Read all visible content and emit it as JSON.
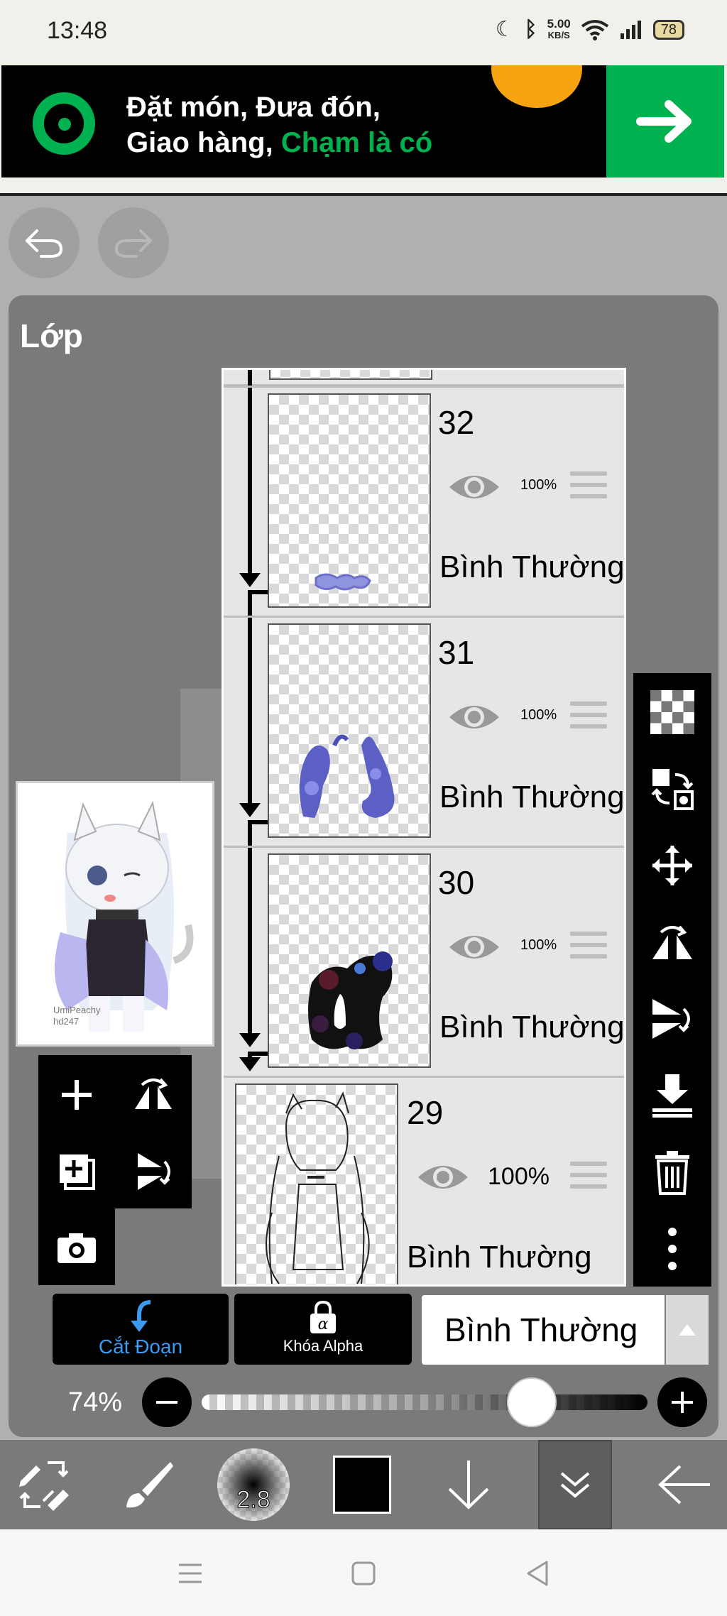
{
  "status": {
    "time": "13:48",
    "net_speed_value": "5.00",
    "net_speed_unit": "KB/S",
    "battery": "78"
  },
  "ad": {
    "line1": "Đặt món, Đưa đón,",
    "line2_white": "Giao hàng,",
    "line2_green": "Chạm là có"
  },
  "panel": {
    "title": "Lớp",
    "preview_watermark_1": "UmiPeachy",
    "preview_watermark_2": "hd247"
  },
  "layers": [
    {
      "number": "32",
      "opacity": "100%",
      "blend": "Bình Thường"
    },
    {
      "number": "31",
      "opacity": "100%",
      "blend": "Bình Thường"
    },
    {
      "number": "30",
      "opacity": "100%",
      "blend": "Bình Thường"
    },
    {
      "number": "29",
      "opacity": "100%",
      "blend": "Bình Thường"
    }
  ],
  "controls": {
    "clip_label": "Cắt Đoạn",
    "alpha_lock_label": "Khóa Alpha",
    "blend_mode": "Bình Thường",
    "opacity": "74%",
    "opacity_value": 74
  },
  "toolbar": {
    "brush_size": "2.8"
  },
  "colors": {
    "accent_blue": "#3a9bf0",
    "grab_green": "#00b14f",
    "panel_bg": "#7a7a7a",
    "primary_color": "#000000"
  }
}
